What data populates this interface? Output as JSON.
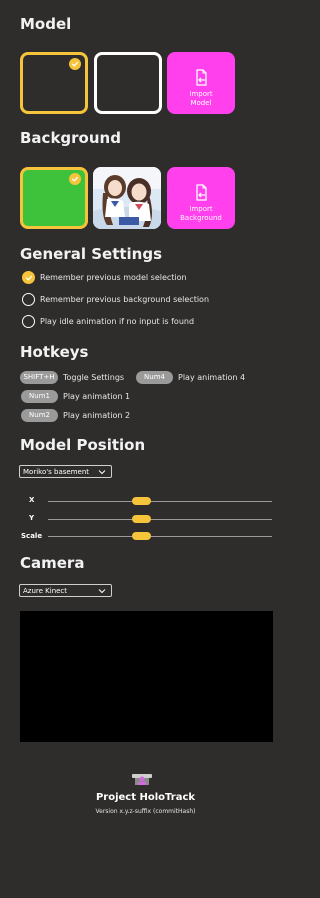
{
  "model": {
    "heading": "Model",
    "import_label": "Import Model"
  },
  "background": {
    "heading": "Background",
    "import_label": "Import Background"
  },
  "general": {
    "heading": "General Settings",
    "options": [
      {
        "label": "Remember previous model selection",
        "checked": true
      },
      {
        "label": "Remember previous background selection",
        "checked": false
      },
      {
        "label": "Play idle animation if no input is found",
        "checked": false
      }
    ]
  },
  "hotkeys": {
    "heading": "Hotkeys",
    "items": [
      {
        "key": "SHIFT+H",
        "action": "Toggle Settings"
      },
      {
        "key": "Num4",
        "action": "Play animation 4"
      },
      {
        "key": "Num1",
        "action": "Play animation 1"
      },
      {
        "key": "Num2",
        "action": "Play animation 2"
      }
    ]
  },
  "position": {
    "heading": "Model Position",
    "preset": "Moriko's basement",
    "sliders": [
      {
        "label": "X",
        "value": 0.41
      },
      {
        "label": "Y",
        "value": 0.41
      },
      {
        "label": "Scale",
        "value": 0.41
      }
    ]
  },
  "camera": {
    "heading": "Camera",
    "device": "Azure Kinect"
  },
  "footer": {
    "title": "Project HoloTrack",
    "version": "Version x.y.z-suffix (commitHash)"
  },
  "colors": {
    "accent": "#f6c43a",
    "import_tile": "#ff40ec",
    "green_bg": "#3ec23c",
    "panel_bg": "#2f2d2c"
  }
}
